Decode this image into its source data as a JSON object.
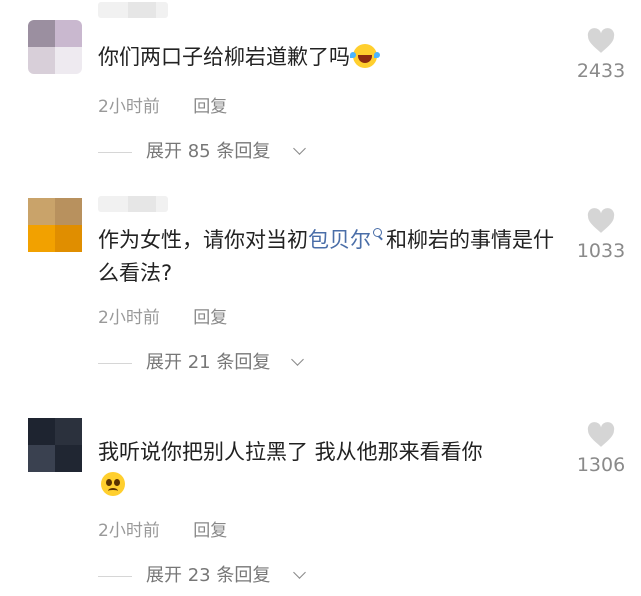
{
  "comments": [
    {
      "text": "你们两口子给柳岩道歉了吗",
      "emoji": "laughing-tears-emoji",
      "time": "2小时前",
      "reply_label": "回复",
      "expand_label": "展开 85 条回复",
      "likes": "2433",
      "avatar_colors": [
        "#9b8fa0",
        "#c9b8cf",
        "#d8cfd9",
        "#eeeaf0"
      ]
    },
    {
      "text_before": "作为女性，请你对当初",
      "mention": "包贝尔",
      "text_after": "和柳岩的事情是什么看法?",
      "time": "2小时前",
      "reply_label": "回复",
      "expand_label": "展开 21 条回复",
      "likes": "1033",
      "avatar_colors": [
        "#c9a36a",
        "#b8915e",
        "#f2a100",
        "#e08e00"
      ]
    },
    {
      "text": "我听说你把别人拉黑了 我从他那来看看你",
      "emoji": "pleading-face-emoji",
      "time": "2小时前",
      "reply_label": "回复",
      "expand_label": "展开 23 条回复",
      "likes": "1306",
      "avatar_colors": [
        "#1e2430",
        "#2b313d",
        "#3a4150",
        "#202632"
      ]
    }
  ],
  "colors": {
    "text": "#222222",
    "meta": "#999999",
    "mention": "#4a6ea8",
    "like": "#8a8a8a"
  },
  "icons": {
    "like": "heart-icon",
    "expand": "chevron-down-icon",
    "mention": "search-icon"
  }
}
